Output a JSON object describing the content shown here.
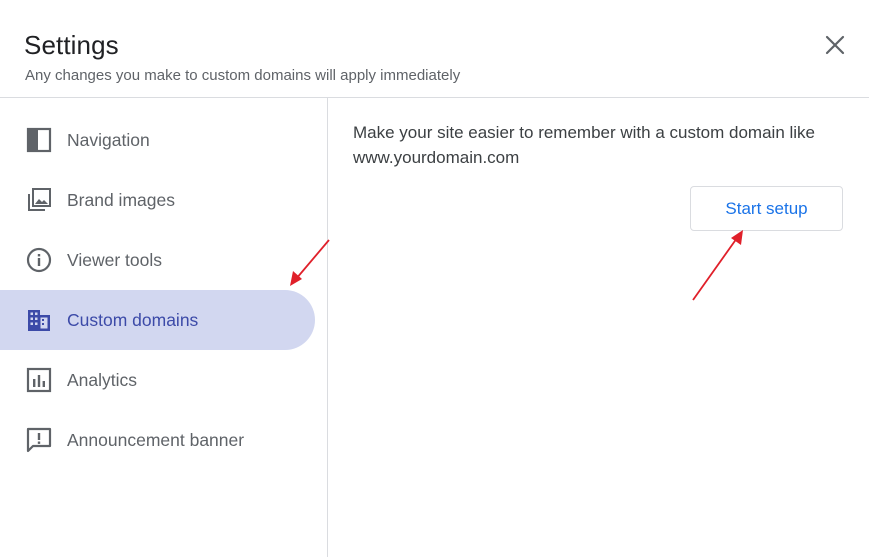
{
  "dialog": {
    "title": "Settings",
    "subtitle": "Any changes you make to custom domains will apply immediately",
    "close_icon": "close-icon"
  },
  "sidebar": {
    "items": [
      {
        "label": "Navigation",
        "icon": "navigation-panel-icon",
        "active": false
      },
      {
        "label": "Brand images",
        "icon": "brand-images-icon",
        "active": false
      },
      {
        "label": "Viewer tools",
        "icon": "info-icon",
        "active": false
      },
      {
        "label": "Custom domains",
        "icon": "domain-building-icon",
        "active": true
      },
      {
        "label": "Analytics",
        "icon": "analytics-icon",
        "active": false
      },
      {
        "label": "Announcement banner",
        "icon": "announcement-icon",
        "active": false
      }
    ]
  },
  "content": {
    "description": "Make your site easier to remember with a custom domain like www.yourdomain.com",
    "setup_label": "Start setup"
  },
  "colors": {
    "accent": "#1a73e8",
    "active_bg": "#d2d7f0",
    "active_text": "#3c4aa8",
    "annotation_arrow": "#e0202a"
  }
}
